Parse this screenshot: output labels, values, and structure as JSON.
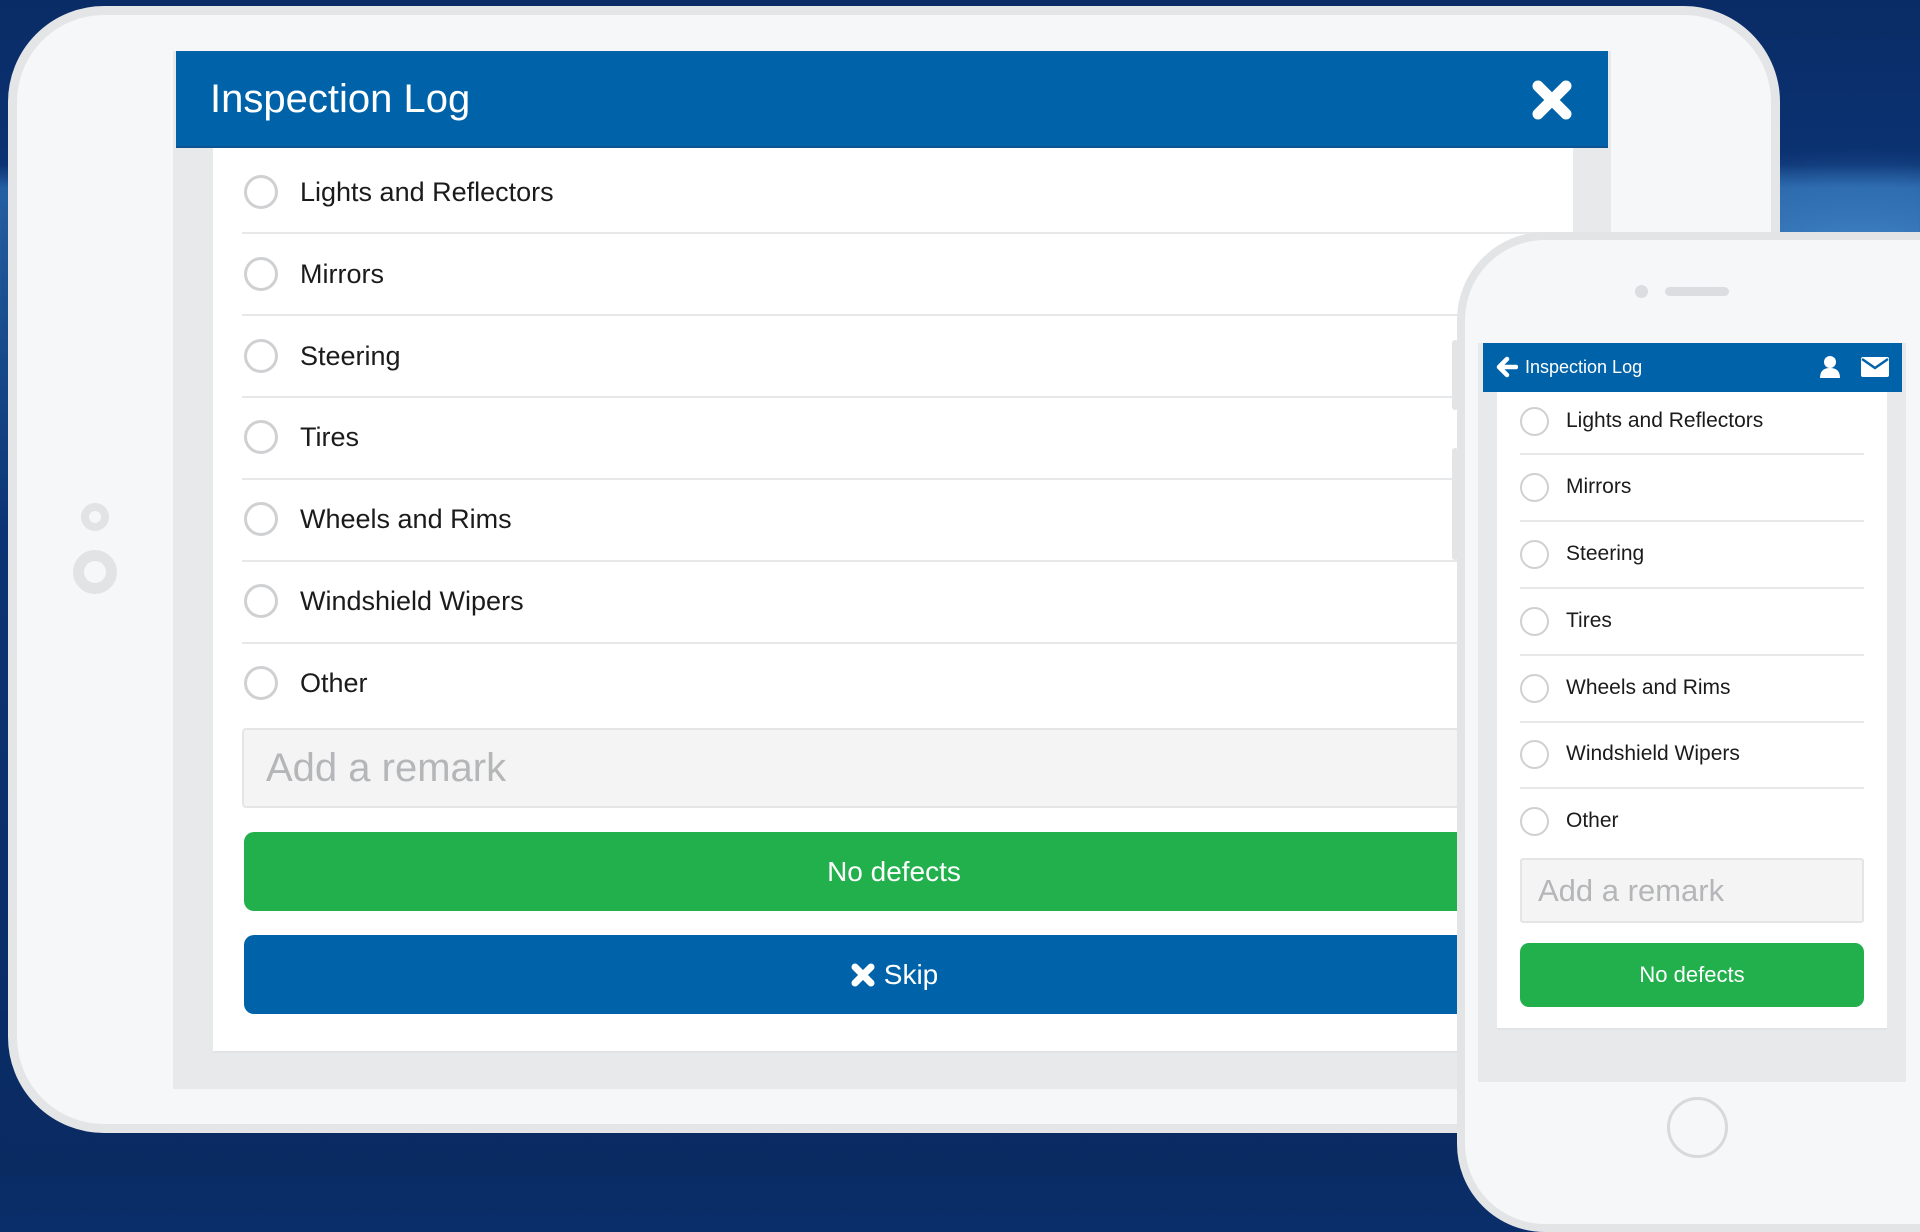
{
  "colors": {
    "header_blue": "#0063a9",
    "success_green": "#22b04d",
    "skip_blue": "#0062a8",
    "background_navy": "#0b2e6b"
  },
  "tablet": {
    "header": {
      "title": "Inspection Log",
      "close_icon": "close-icon"
    },
    "checklist": [
      {
        "label": "Lights and Reflectors",
        "checked": false
      },
      {
        "label": "Mirrors",
        "checked": false
      },
      {
        "label": "Steering",
        "checked": false
      },
      {
        "label": "Tires",
        "checked": false
      },
      {
        "label": "Wheels and Rims",
        "checked": false
      },
      {
        "label": "Windshield Wipers",
        "checked": false
      },
      {
        "label": "Other",
        "checked": false
      }
    ],
    "remark": {
      "value": "",
      "placeholder": "Add a remark"
    },
    "buttons": {
      "no_defects": "No defects",
      "skip": "Skip",
      "skip_icon": "close-icon"
    }
  },
  "phone": {
    "header": {
      "title": "Inspection Log",
      "back_icon": "arrow-left-icon",
      "user_icon": "user-icon",
      "mail_icon": "envelope-icon"
    },
    "checklist": [
      {
        "label": "Lights and Reflectors",
        "checked": false
      },
      {
        "label": "Mirrors",
        "checked": false
      },
      {
        "label": "Steering",
        "checked": false
      },
      {
        "label": "Tires",
        "checked": false
      },
      {
        "label": "Wheels and Rims",
        "checked": false
      },
      {
        "label": "Windshield Wipers",
        "checked": false
      },
      {
        "label": "Other",
        "checked": false
      }
    ],
    "remark": {
      "value": "",
      "placeholder": "Add a remark"
    },
    "buttons": {
      "no_defects": "No defects"
    }
  }
}
